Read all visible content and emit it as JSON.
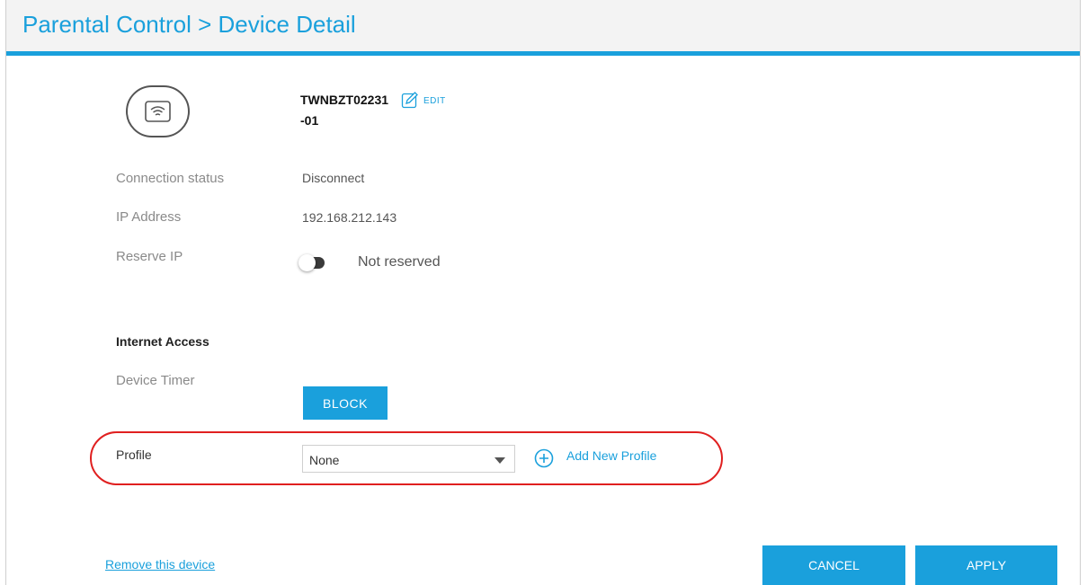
{
  "header": {
    "title": "Parental Control > Device Detail"
  },
  "device": {
    "icon": "wifi-device-icon",
    "name_line1": "TWNBZT02231",
    "name_line2": "-01",
    "edit_label": "EDIT"
  },
  "details": {
    "connection_status_label": "Connection status",
    "connection_status_value": "Disconnect",
    "ip_address_label": "IP Address",
    "ip_address_value": "192.168.212.143",
    "reserve_ip_label": "Reserve IP",
    "reserve_ip_state": "Not reserved",
    "reserve_ip_on": false
  },
  "internet_access": {
    "section_title": "Internet Access",
    "device_timer_label": "Device Timer",
    "block_button": "BLOCK",
    "profile_label": "Profile",
    "profile_selected": "None",
    "add_profile_label": "Add New Profile"
  },
  "footer": {
    "remove_link": "Remove this device",
    "cancel_button": "CANCEL",
    "apply_button": "APPLY"
  },
  "colors": {
    "accent": "#1aa0dc",
    "highlight": "#e02020"
  }
}
